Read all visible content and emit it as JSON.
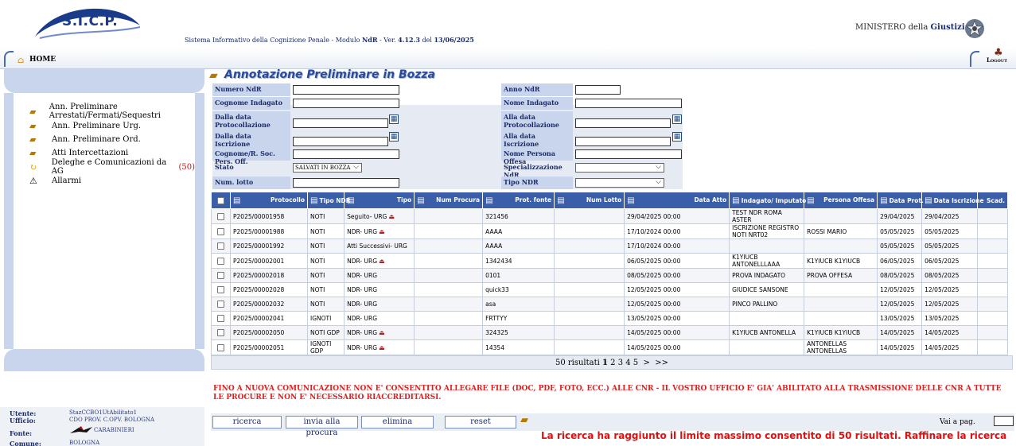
{
  "header": {
    "logo": "S.I.C.P.",
    "system_title_pre": "Sistema Informativo della Cognizione Penale - Modulo ",
    "system_title_module": "NdR",
    "system_title_mid": " - Ver. ",
    "system_title_version": "4.12.3",
    "system_title_del": " del ",
    "system_title_date": "13/06/2025",
    "ministero_pre": "MINISTERO della ",
    "ministero_bold": "Giustizia"
  },
  "nav": {
    "home_label": "HOME",
    "logout_label": "Logout"
  },
  "sidebar": {
    "items": [
      {
        "label": "Ann. Preliminare Arrestati/Fermati/Sequestri",
        "icon": "folder-icon"
      },
      {
        "label": "Ann. Preliminare Urg.",
        "icon": "folder-icon"
      },
      {
        "label": "Ann. Preliminare Ord.",
        "icon": "folder-icon"
      },
      {
        "label": "Atti Intercettazioni",
        "icon": "folder-icon"
      },
      {
        "label": "Deleghe e Comunicazioni da AG ",
        "count": "(50)",
        "icon": "refresh-icon"
      },
      {
        "label": "Allarmi",
        "icon": "warning-icon"
      }
    ]
  },
  "form": {
    "title": "Annotazione Preliminare in Bozza",
    "numero_ndr": "Numero NdR",
    "anno_ndr": "Anno NdR",
    "cognome_indagato": "Cognome Indagato",
    "nome_indagato": "Nome Indagato",
    "dalla_data_prot": "Dalla data Protocollazione",
    "alla_data_prot": "Alla data Protocollazione",
    "dalla_data_iscr": "Dalla data Iscrizione",
    "alla_data_iscr": "Alla data Iscrizione",
    "cognome_rsoc": "Cognome/R. Soc. Pers. Off.",
    "nome_persona_offesa": "Nome Persona Offesa",
    "stato": "Stato",
    "stato_value": "SALVATI IN BOZZA",
    "specializzazione": "Specializzazione NdR",
    "num_lotto": "Num. lotto",
    "tipo_ndr": "Tipo NDR"
  },
  "table": {
    "headers": [
      "Protocollo",
      "Tipo NDR",
      "Tipo",
      "Num Procura",
      "Prot. fonte",
      "Num Lotto",
      "Data Atto",
      "Indagato/ Imputato",
      "Persona Offesa",
      "Data Prot.",
      "Data Iscrizione",
      "Scad."
    ],
    "rows": [
      {
        "protocollo": "P2025/00001958",
        "tipo_ndr": "NOTI",
        "tipo": "Seguito- URG",
        "lock": true,
        "num_procura": "",
        "prot_fonte": "321456",
        "num_lotto": "",
        "data_atto": "29/04/2025 00:00",
        "indagato": "TEST NDR ROMA ASTER",
        "persona_offesa": "",
        "data_prot": "29/04/2025",
        "data_iscr": "29/04/2025",
        "scad": ""
      },
      {
        "protocollo": "P2025/00001988",
        "tipo_ndr": "NOTI",
        "tipo": "NDR- URG",
        "lock": true,
        "num_procura": "",
        "prot_fonte": "AAAA",
        "num_lotto": "",
        "data_atto": "17/10/2024 00:00",
        "indagato": "ISCRIZIONE REGISTRO NOTI NRT02",
        "persona_offesa": "ROSSI MARIO",
        "data_prot": "05/05/2025",
        "data_iscr": "05/05/2025",
        "scad": ""
      },
      {
        "protocollo": "P2025/00001992",
        "tipo_ndr": "NOTI",
        "tipo": "Atti Successivi- URG",
        "lock": false,
        "num_procura": "",
        "prot_fonte": "AAAA",
        "num_lotto": "",
        "data_atto": "17/10/2024 00:00",
        "indagato": "",
        "persona_offesa": "",
        "data_prot": "05/05/2025",
        "data_iscr": "05/05/2025",
        "scad": ""
      },
      {
        "protocollo": "P2025/00002001",
        "tipo_ndr": "NOTI",
        "tipo": "NDR- URG",
        "lock": true,
        "num_procura": "",
        "prot_fonte": "1342434",
        "num_lotto": "",
        "data_atto": "06/05/2025 00:00",
        "indagato": "K1YIUCB ANTONELLLAAA",
        "persona_offesa": "K1YIUCB K1YIUCB",
        "data_prot": "06/05/2025",
        "data_iscr": "06/05/2025",
        "scad": ""
      },
      {
        "protocollo": "P2025/00002018",
        "tipo_ndr": "NOTI",
        "tipo": "NDR- URG",
        "lock": false,
        "num_procura": "",
        "prot_fonte": "0101",
        "num_lotto": "",
        "data_atto": "08/05/2025 00:00",
        "indagato": "PROVA INDAGATO",
        "persona_offesa": "PROVA OFFESA",
        "data_prot": "08/05/2025",
        "data_iscr": "08/05/2025",
        "scad": ""
      },
      {
        "protocollo": "P2025/00002028",
        "tipo_ndr": "NOTI",
        "tipo": "NDR- URG",
        "lock": false,
        "num_procura": "",
        "prot_fonte": "quick33",
        "num_lotto": "",
        "data_atto": "12/05/2025 00:00",
        "indagato": "GIUDICE SANSONE",
        "persona_offesa": "",
        "data_prot": "12/05/2025",
        "data_iscr": "12/05/2025",
        "scad": ""
      },
      {
        "protocollo": "P2025/00002032",
        "tipo_ndr": "NOTI",
        "tipo": "NDR- URG",
        "lock": false,
        "num_procura": "",
        "prot_fonte": "asa",
        "num_lotto": "",
        "data_atto": "12/05/2025 00:00",
        "indagato": "PINCO PALLINO",
        "persona_offesa": "",
        "data_prot": "12/05/2025",
        "data_iscr": "12/05/2025",
        "scad": ""
      },
      {
        "protocollo": "P2025/00002041",
        "tipo_ndr": "IGNOTI",
        "tipo": "NDR- URG",
        "lock": false,
        "num_procura": "",
        "prot_fonte": "FRTTYY",
        "num_lotto": "",
        "data_atto": "13/05/2025 00:00",
        "indagato": "",
        "persona_offesa": "",
        "data_prot": "13/05/2025",
        "data_iscr": "13/05/2025",
        "scad": ""
      },
      {
        "protocollo": "P2025/00002050",
        "tipo_ndr": "NOTI GDP",
        "tipo": "NDR- URG",
        "lock": true,
        "num_procura": "",
        "prot_fonte": "324325",
        "num_lotto": "",
        "data_atto": "14/05/2025 00:00",
        "indagato": "K1YIUCB ANTONELLA",
        "persona_offesa": "K1YIUCB K1YIUCB",
        "data_prot": "14/05/2025",
        "data_iscr": "14/05/2025",
        "scad": ""
      },
      {
        "protocollo": "P2025/00002051",
        "tipo_ndr": "IGNOTI GDP",
        "tipo": "NDR- URG",
        "lock": true,
        "num_procura": "",
        "prot_fonte": "14354",
        "num_lotto": "",
        "data_atto": "14/05/2025 00:00",
        "indagato": "",
        "persona_offesa": "ANTONELLAS ANTONELLAS",
        "data_prot": "14/05/2025",
        "data_iscr": "14/05/2025",
        "scad": ""
      }
    ],
    "results_text": "50 risultati ",
    "current_page": "1",
    "pages": "2 3 4 5",
    "next": ">",
    "last": ">>"
  },
  "warning": "FINO A NUOVA COMUNICAZIONE NON E' CONSENTITO ALLEGARE FILE (DOC, PDF, FOTO, ECC.) ALLE CNR - IL VOSTRO UFFICIO E' GIA' ABILITATO ALLA TRASMISSIONE DELLE CNR A TUTTE LE PROCURE E NON E' NECESSARIO RIACCREDITARSI.",
  "limit_message": "La ricerca ha raggiunto il limite massimo consentito di 50 risultati. Raffinare la ricerca",
  "user": {
    "utente_label": "Utente:",
    "utente": "StazCCBO1UtAbilitato1",
    "ufficio_label": "Ufficio:",
    "ufficio": "CDO PROV. C.OPV. BOLOGNA",
    "fonte_label": "Fonte:",
    "fonte": "CARABINIERI",
    "comune_label": "Comune:",
    "comune": "BOLOGNA"
  },
  "buttons": {
    "ricerca": "ricerca",
    "invia": "invia alla procura",
    "elimina": "elimina",
    "reset": "reset",
    "goto_label": "Vai a pag."
  },
  "colors": {
    "header_blue": "#3b5ea8",
    "panel": "#c8d5ec",
    "warning_red": "#e02020"
  }
}
